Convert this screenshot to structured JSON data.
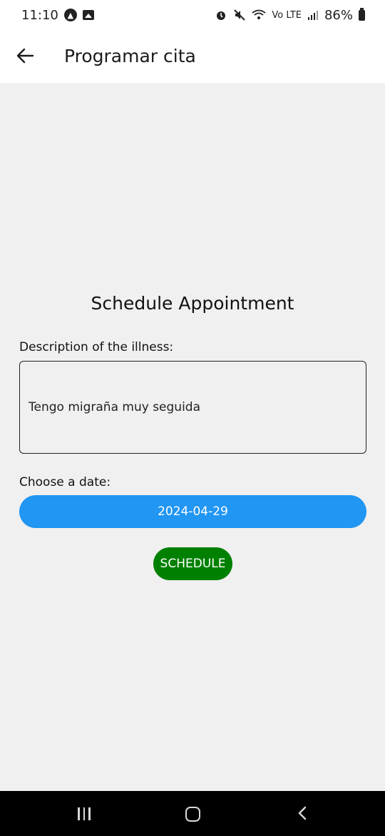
{
  "status_bar": {
    "time": "11:10",
    "network_label": "Vo LTE",
    "battery": "86%"
  },
  "app_bar": {
    "title": "Programar cita"
  },
  "form": {
    "heading": "Schedule Appointment",
    "description_label": "Description of the illness:",
    "description_value": "Tengo migraña muy seguida",
    "date_label": "Choose a date:",
    "date_value": "2024-04-29",
    "schedule_label": "SCHEDULE"
  },
  "colors": {
    "date_button": "#2196f3",
    "schedule_button": "#008000",
    "background": "#f0f0f0"
  }
}
